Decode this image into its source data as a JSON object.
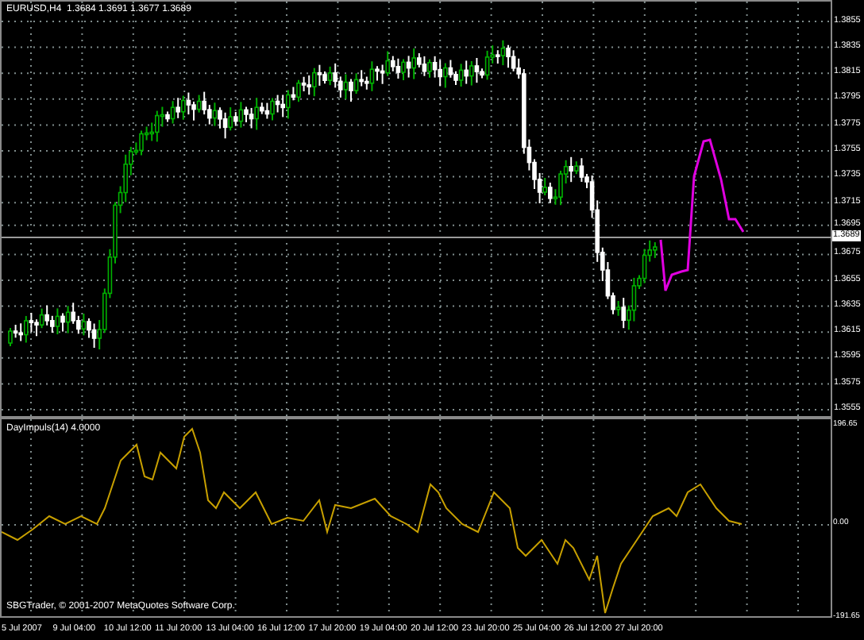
{
  "price_chart": {
    "title": "EURUSD,H4  1.3684 1.3691 1.3677 1.3689",
    "price_labels": [
      "1.3855",
      "1.3835",
      "1.3815",
      "1.3795",
      "1.3775",
      "1.3755",
      "1.3735",
      "1.3715",
      "1.3695",
      "1.3675",
      "1.3655",
      "1.3635",
      "1.3615",
      "1.3595",
      "1.3575",
      "1.3555"
    ],
    "current_price": "1.3689"
  },
  "indicator": {
    "title": "DayImpuls(14) 4.0000",
    "copyright": "SBGTrader, © 2001-2007 MetaQuotes Software Corp.",
    "scale_labels": [
      "196.65",
      "0.00",
      "-191.65"
    ]
  },
  "time_labels": [
    "5 Jul 2007",
    "9 Jul 04:00",
    "10 Jul 12:00",
    "11 Jul 20:00",
    "13 Jul 04:00",
    "16 Jul 12:00",
    "17 Jul 20:00",
    "19 Jul 04:00",
    "20 Jul 12:00",
    "23 Jul 20:00",
    "25 Jul 04:00",
    "26 Jul 12:00",
    "27 Jul 20:00"
  ]
}
